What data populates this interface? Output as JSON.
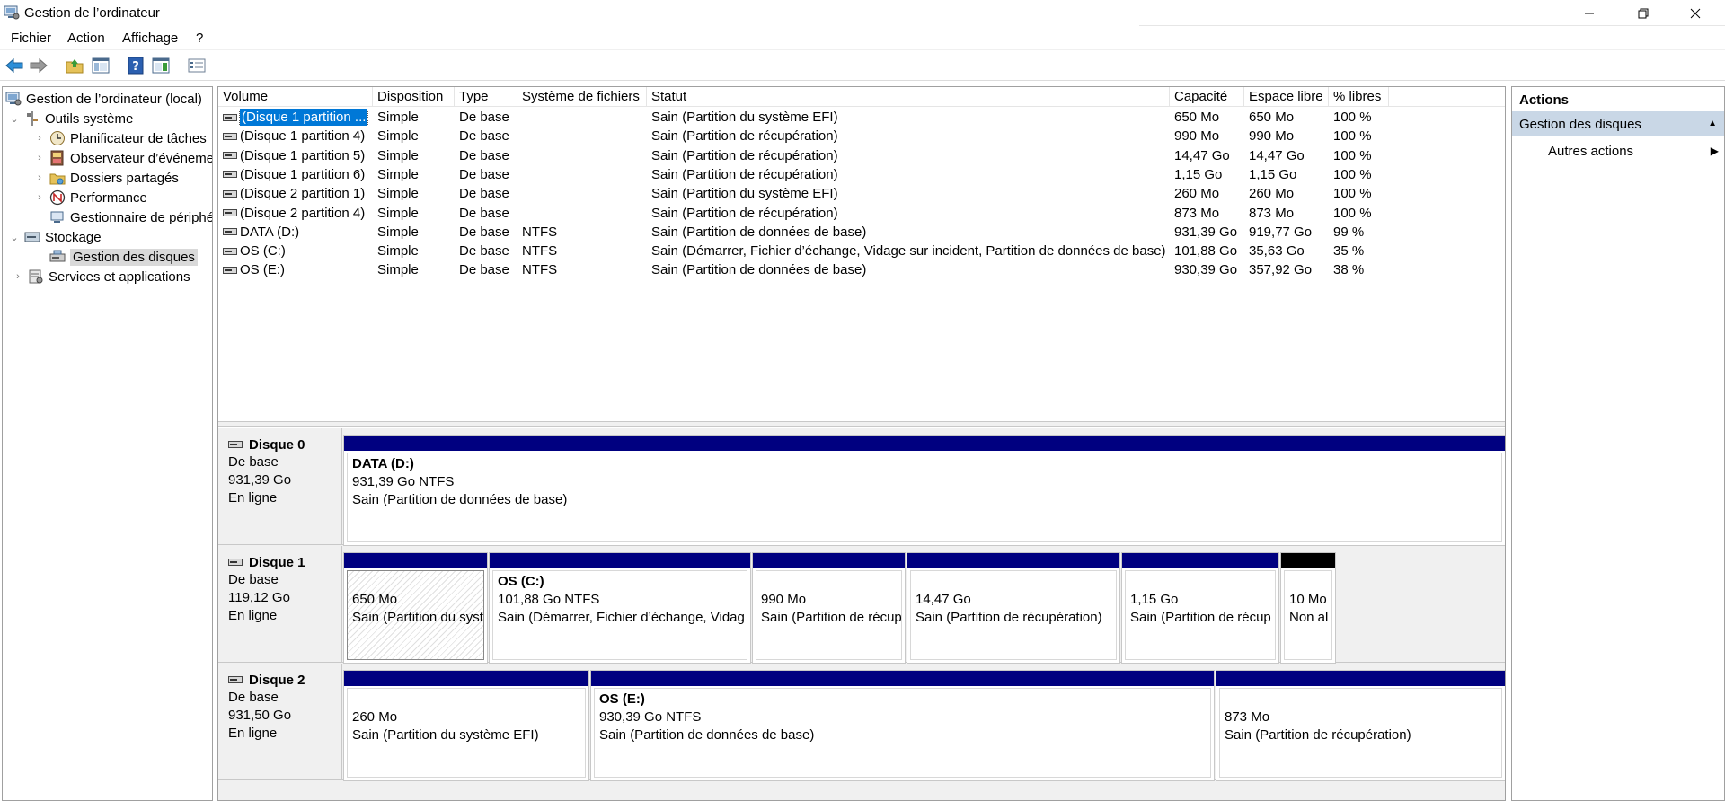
{
  "window": {
    "title": "Gestion de l’ordinateur"
  },
  "menu": [
    "Fichier",
    "Action",
    "Affichage",
    "?"
  ],
  "toolbar": {
    "icons": [
      "back-arrow-icon",
      "forward-arrow-icon",
      "up-folder-icon",
      "show-hide-tree-icon",
      "help-icon",
      "show-hide-action-pane-icon",
      "properties-icon"
    ]
  },
  "tree": [
    {
      "label": "Gestion de l’ordinateur (local)",
      "level": 0,
      "icon": "computer-management-icon",
      "expander": ""
    },
    {
      "label": "Outils système",
      "level": 1,
      "icon": "system-tools-icon",
      "expander": "expanded"
    },
    {
      "label": "Planificateur de tâches",
      "level": 2,
      "icon": "task-scheduler-icon",
      "expander": "collapsed"
    },
    {
      "label": "Observateur d’événeme",
      "level": 2,
      "icon": "event-viewer-icon",
      "expander": "collapsed"
    },
    {
      "label": "Dossiers partagés",
      "level": 2,
      "icon": "shared-folders-icon",
      "expander": "collapsed"
    },
    {
      "label": "Performance",
      "level": 2,
      "icon": "performance-icon",
      "expander": "collapsed"
    },
    {
      "label": "Gestionnaire de périphé",
      "level": 2,
      "icon": "device-manager-icon",
      "expander": ""
    },
    {
      "label": "Stockage",
      "level": 1,
      "icon": "storage-icon",
      "expander": "expanded"
    },
    {
      "label": "Gestion des disques",
      "level": 2,
      "icon": "disk-management-icon",
      "expander": "",
      "selected": true
    },
    {
      "label": "Services et applications",
      "level": 1,
      "icon": "services-apps-icon",
      "expander": "collapsed"
    }
  ],
  "volume_table": {
    "headers": [
      "Volume",
      "Disposition",
      "Type",
      "Système de fichiers",
      "Statut",
      "Capacité",
      "Espace libre",
      "% libres"
    ],
    "rows": [
      [
        "(Disque 1 partition ...",
        "Simple",
        "De base",
        "",
        "Sain (Partition du système EFI)",
        "650 Mo",
        "650 Mo",
        "100 %"
      ],
      [
        "(Disque 1 partition 4)",
        "Simple",
        "De base",
        "",
        "Sain (Partition de récupération)",
        "990 Mo",
        "990 Mo",
        "100 %"
      ],
      [
        "(Disque 1 partition 5)",
        "Simple",
        "De base",
        "",
        "Sain (Partition de récupération)",
        "14,47 Go",
        "14,47 Go",
        "100 %"
      ],
      [
        "(Disque 1 partition 6)",
        "Simple",
        "De base",
        "",
        "Sain (Partition de récupération)",
        "1,15 Go",
        "1,15 Go",
        "100 %"
      ],
      [
        "(Disque 2 partition 1)",
        "Simple",
        "De base",
        "",
        "Sain (Partition du système EFI)",
        "260 Mo",
        "260 Mo",
        "100 %"
      ],
      [
        "(Disque 2 partition 4)",
        "Simple",
        "De base",
        "",
        "Sain (Partition de récupération)",
        "873 Mo",
        "873 Mo",
        "100 %"
      ],
      [
        "DATA (D:)",
        "Simple",
        "De base",
        "NTFS",
        "Sain (Partition de données de base)",
        "931,39 Go",
        "919,77 Go",
        "99 %"
      ],
      [
        "OS (C:)",
        "Simple",
        "De base",
        "NTFS",
        "Sain (Démarrer, Fichier d’échange, Vidage sur incident, Partition de données de base)",
        "101,88 Go",
        "35,63 Go",
        "35 %"
      ],
      [
        "OS (E:)",
        "Simple",
        "De base",
        "NTFS",
        "Sain (Partition de données de base)",
        "930,39 Go",
        "357,92 Go",
        "38 %"
      ]
    ]
  },
  "disks": [
    {
      "name": "Disque 0",
      "type": "De base",
      "size": "931,39 Go",
      "status": "En ligne",
      "partitions": [
        {
          "title": "DATA  (D:)",
          "size": "931,39 Go NTFS",
          "status": "Sain (Partition de données de base)",
          "bar": "blue"
        }
      ]
    },
    {
      "name": "Disque 1",
      "type": "De base",
      "size": "119,12 Go",
      "status": "En ligne",
      "partitions": [
        {
          "title": "",
          "size": "650 Mo",
          "status": "Sain (Partition du syst",
          "bar": "blue",
          "hatched": true
        },
        {
          "title": "OS  (C:)",
          "size": "101,88 Go NTFS",
          "status": "Sain (Démarrer, Fichier d’échange, Vidag",
          "bar": "blue"
        },
        {
          "title": "",
          "size": "990 Mo",
          "status": "Sain (Partition de récup",
          "bar": "blue"
        },
        {
          "title": "",
          "size": "14,47 Go",
          "status": "Sain (Partition de récupération)",
          "bar": "blue"
        },
        {
          "title": "",
          "size": "1,15 Go",
          "status": "Sain (Partition de récup",
          "bar": "blue"
        },
        {
          "title": "",
          "size": "10 Mo",
          "status": "Non al",
          "bar": "black"
        }
      ]
    },
    {
      "name": "Disque 2",
      "type": "De base",
      "size": "931,50 Go",
      "status": "En ligne",
      "partitions": [
        {
          "title": "",
          "size": "260 Mo",
          "status": "Sain (Partition du système EFI)",
          "bar": "blue"
        },
        {
          "title": "OS  (E:)",
          "size": "930,39 Go NTFS",
          "status": "Sain (Partition de données de base)",
          "bar": "blue"
        },
        {
          "title": "",
          "size": "873 Mo",
          "status": "Sain (Partition de récupération)",
          "bar": "blue"
        }
      ]
    }
  ],
  "actions": {
    "header": "Actions",
    "section": "Gestion des disques",
    "item": "Autres actions"
  },
  "colors": {
    "partition_bar": "#000080",
    "unallocated_bar": "#000000",
    "selection": "#0078d7",
    "actions_section": "#c9d7e6"
  }
}
